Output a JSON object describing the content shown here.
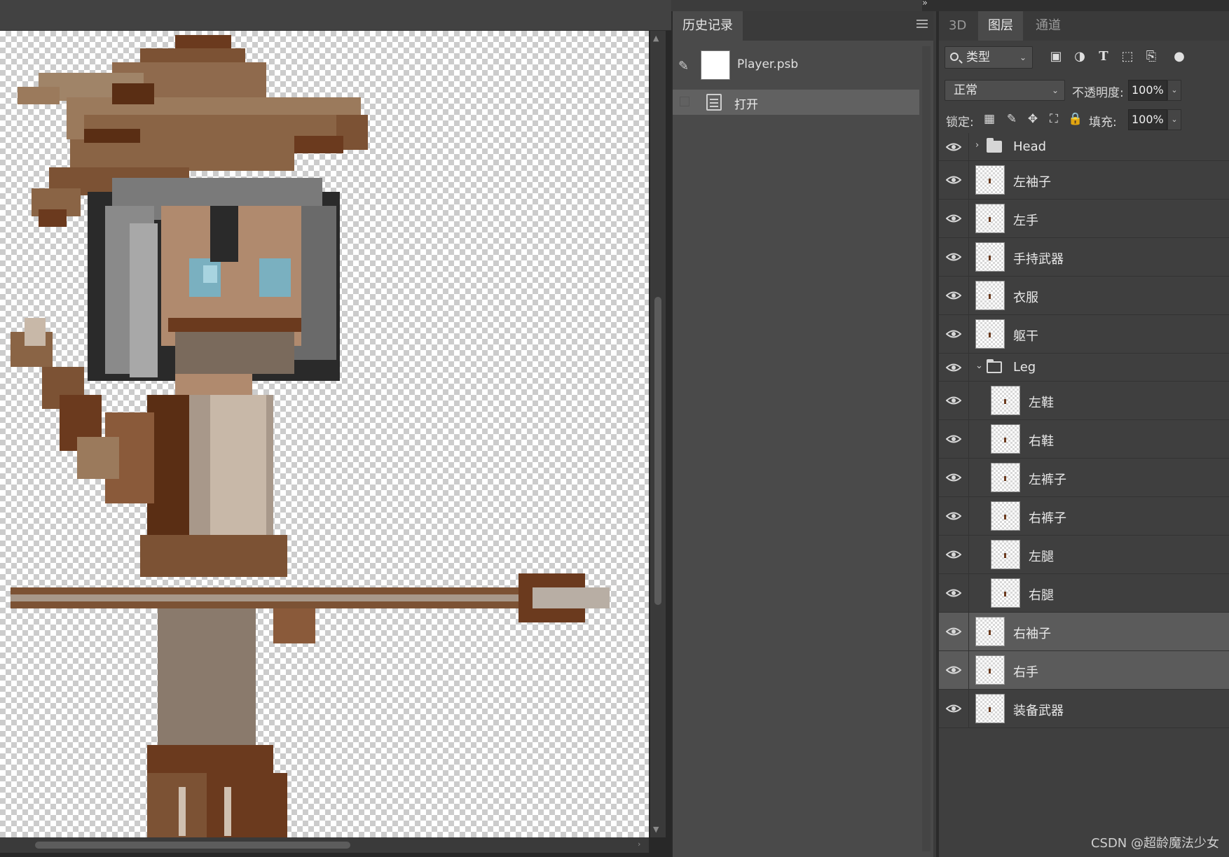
{
  "history_panel": {
    "tab_title": "历史记录",
    "snapshot_name": "Player.psb",
    "items": [
      {
        "label": "打开"
      }
    ]
  },
  "layers_panel": {
    "tabs": [
      {
        "label": "3D",
        "active": false
      },
      {
        "label": "图层",
        "active": true
      },
      {
        "label": "通道",
        "active": false
      }
    ],
    "filter": {
      "label": "类型"
    },
    "blend_mode": "正常",
    "opacity_label": "不透明度:",
    "opacity_value": "100%",
    "lock_label": "锁定:",
    "fill_label": "填充:",
    "fill_value": "100%",
    "layers": [
      {
        "name": "Head",
        "type": "group",
        "expanded": false,
        "indent": 0,
        "selected": false
      },
      {
        "name": "左袖子",
        "type": "layer",
        "indent": 0,
        "selected": false
      },
      {
        "name": "左手",
        "type": "layer",
        "indent": 0,
        "selected": false
      },
      {
        "name": "手持武器",
        "type": "layer",
        "indent": 0,
        "selected": false
      },
      {
        "name": "衣服",
        "type": "layer",
        "indent": 0,
        "selected": false
      },
      {
        "name": "躯干",
        "type": "layer",
        "indent": 0,
        "selected": false
      },
      {
        "name": "Leg",
        "type": "group",
        "expanded": true,
        "indent": 0,
        "selected": false
      },
      {
        "name": "左鞋",
        "type": "layer",
        "indent": 1,
        "selected": false
      },
      {
        "name": "右鞋",
        "type": "layer",
        "indent": 1,
        "selected": false
      },
      {
        "name": "左裤子",
        "type": "layer",
        "indent": 1,
        "selected": false
      },
      {
        "name": "右裤子",
        "type": "layer",
        "indent": 1,
        "selected": false
      },
      {
        "name": "左腿",
        "type": "layer",
        "indent": 1,
        "selected": false
      },
      {
        "name": "右腿",
        "type": "layer",
        "indent": 1,
        "selected": false
      },
      {
        "name": "右袖子",
        "type": "layer",
        "indent": 0,
        "selected": true
      },
      {
        "name": "右手",
        "type": "layer",
        "indent": 0,
        "selected": true
      },
      {
        "name": "装备武器",
        "type": "layer",
        "indent": 0,
        "selected": false
      }
    ]
  },
  "watermark": "CSDN @超龄魔法少女",
  "colors": {
    "panel_bg": "#3f3f3f",
    "selected_row": "#5b5b5b",
    "sprite_dark_brown": "#5a2e14",
    "sprite_mid_brown": "#8a5a3a",
    "sprite_hat_tan": "#9b7a5c",
    "sprite_skin": "#b08a6e",
    "sprite_hair_gray": "#8a8a8a",
    "sprite_eye_blue": "#7ab0c0"
  }
}
